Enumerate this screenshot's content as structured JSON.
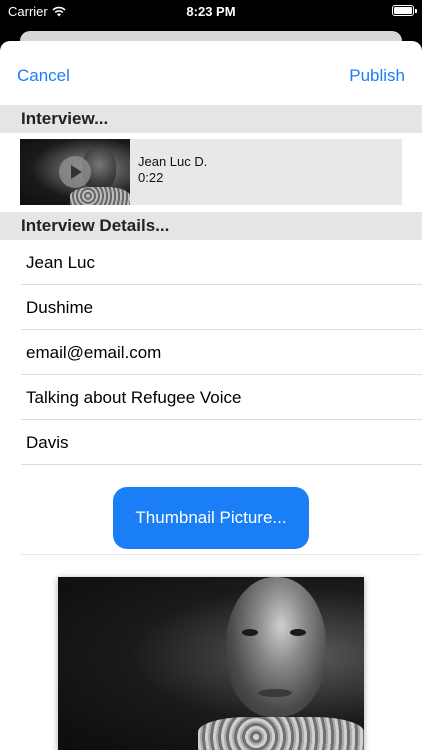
{
  "status_bar": {
    "carrier": "Carrier",
    "time": "8:23 PM",
    "battery_level": 1.0
  },
  "nav": {
    "cancel_label": "Cancel",
    "publish_label": "Publish"
  },
  "interview_section": {
    "header": "Interview...",
    "item": {
      "name": "Jean Luc D.",
      "duration": "0:22",
      "play_icon": "play-icon"
    }
  },
  "details_section": {
    "header": "Interview Details...",
    "fields": [
      "Jean Luc",
      "Dushime",
      "email@email.com",
      "Talking about Refugee Voice",
      "Davis"
    ]
  },
  "thumbnail_button_label": "Thumbnail Picture...",
  "colors": {
    "accent": "#1a7ff6",
    "section_header_bg": "#e5e5e5"
  }
}
